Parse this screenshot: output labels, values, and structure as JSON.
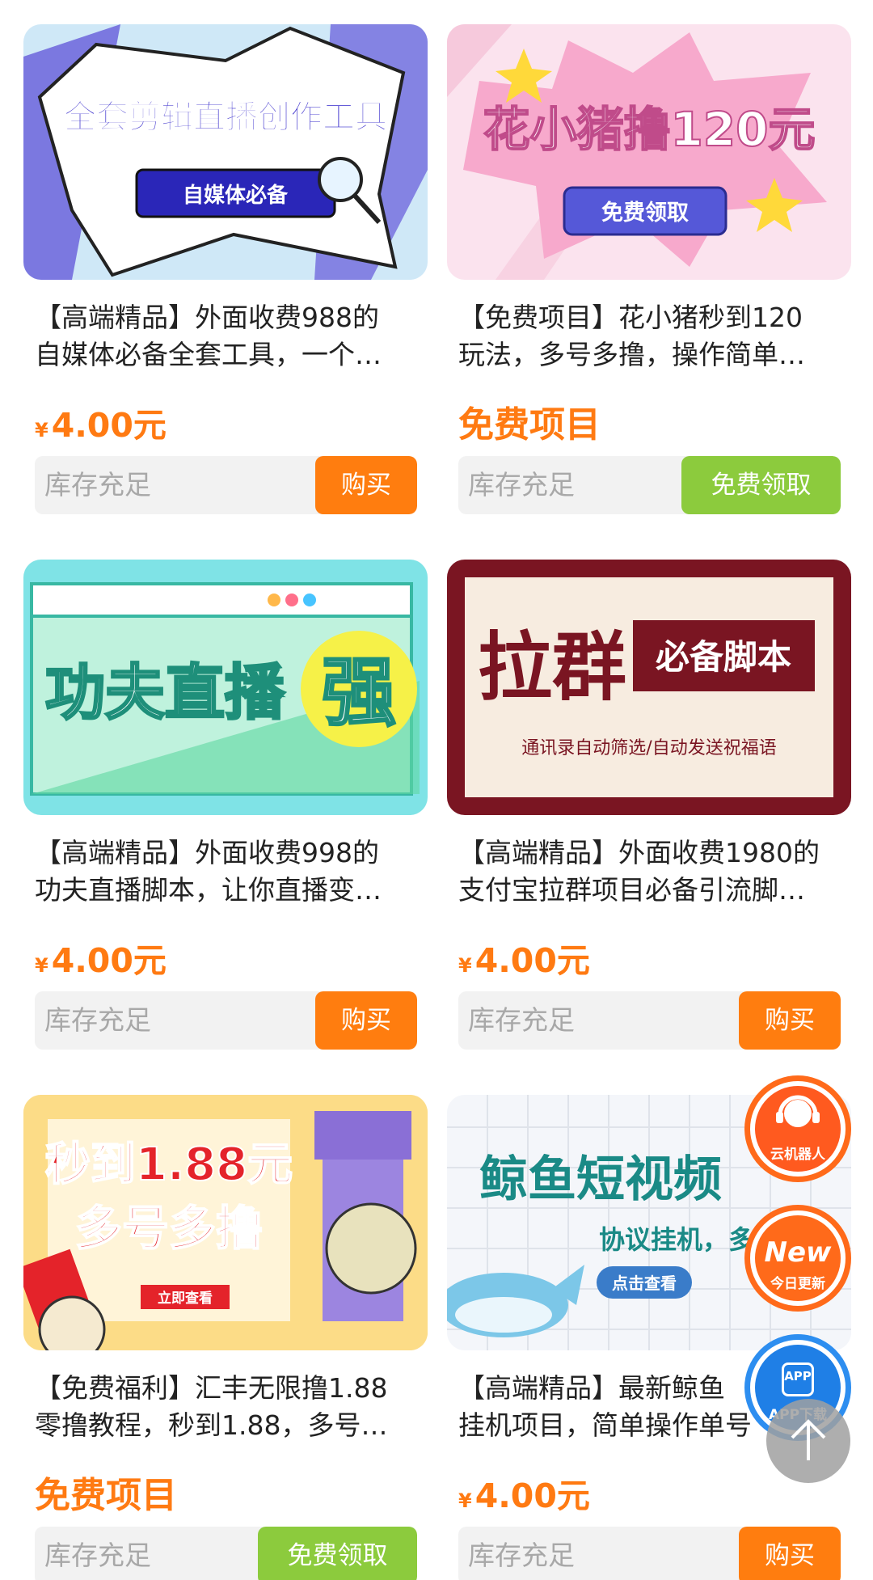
{
  "products": [
    {
      "title_line1": "【高端精品】外面收费988的",
      "title_line2": "自媒体必备全套工具，一个…",
      "price_symbol": "¥",
      "price": "4.00元",
      "stock": "库存充足",
      "button": "购买",
      "banner": {
        "headline": "全套剪辑直播创作工具",
        "sub": "自媒体必备"
      }
    },
    {
      "title_line1": "【免费项目】花小猪秒到120",
      "title_line2": "玩法，多号多撸，操作简单…",
      "price_text": "免费项目",
      "stock": "库存充足",
      "button": "免费领取",
      "banner": {
        "headline": "花小猪撸120元",
        "sub": "免费领取"
      }
    },
    {
      "title_line1": "【高端精品】外面收费998的",
      "title_line2": "功夫直播脚本，让你直播变…",
      "price_symbol": "¥",
      "price": "4.00元",
      "stock": "库存充足",
      "button": "购买",
      "banner": {
        "headline": "功夫直播",
        "badge": "强"
      }
    },
    {
      "title_line1": "【高端精品】外面收费1980的",
      "title_line2": "支付宝拉群项目必备引流脚…",
      "price_symbol": "¥",
      "price": "4.00元",
      "stock": "库存充足",
      "button": "购买",
      "banner": {
        "headline": "拉群",
        "tag": "必备脚本",
        "sub": "通讯录自动筛选/自动发送祝福语"
      }
    },
    {
      "title_line1": "【免费福利】汇丰无限撸1.88",
      "title_line2": "零撸教程，秒到1.88，多号…",
      "price_text": "免费项目",
      "stock": "库存充足",
      "button": "免费领取",
      "banner": {
        "headline_1": "秒到1.88元",
        "headline_2": "多号多撸",
        "sub": "立即查看"
      }
    },
    {
      "title_line1": "【高端精品】最新鲸鱼",
      "title_line2": "挂机项目，简单操作单号",
      "price_symbol": "¥",
      "price": "4.00元",
      "stock": "库存充足",
      "button": "购买",
      "banner": {
        "headline": "鲸鱼短视频",
        "sub": "协议挂机，多号",
        "cta": "点击查看"
      }
    }
  ],
  "floating": {
    "robot_label": "云机器人",
    "new_badge": "New",
    "new_label": "今日更新",
    "app_badge": "APP",
    "app_label": "APP下载",
    "top_icon": "arrow-up-icon"
  },
  "colors": {
    "price_orange": "#ff7a12",
    "buy_button": "#ff7d0f",
    "free_button": "#8ccb3d",
    "stock_bg": "#f2f2f2",
    "fab_orange": "#ff6a1a",
    "fab_blue": "#1f7fe6"
  }
}
